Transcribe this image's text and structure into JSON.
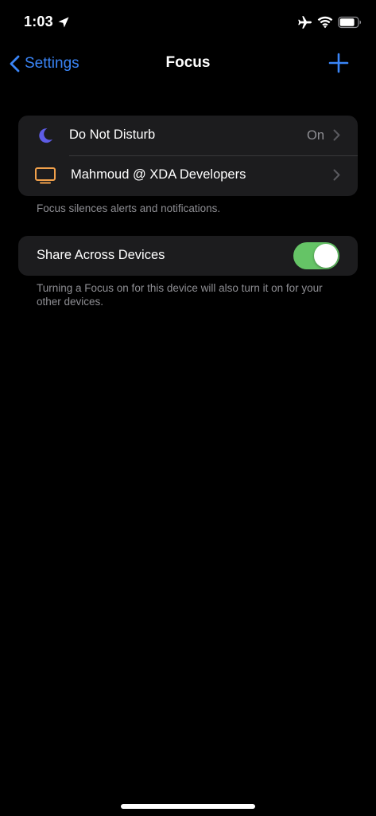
{
  "status_bar": {
    "time": "1:03",
    "icons": [
      "location-arrow-icon",
      "airplane-icon",
      "wifi-icon",
      "battery-icon"
    ]
  },
  "nav": {
    "back_label": "Settings",
    "title": "Focus",
    "add_icon": "plus-icon"
  },
  "focus_list": {
    "items": [
      {
        "label": "Do Not Disturb",
        "value": "On",
        "icon": "moon-icon",
        "icon_color": "#5e5ce6"
      },
      {
        "label": "Mahmoud @ XDA Developers",
        "value": "",
        "icon": "tv-icon",
        "icon_color": "#f0a04b"
      }
    ],
    "footer": "Focus silences alerts and notifications."
  },
  "share": {
    "label": "Share Across Devices",
    "enabled": true,
    "footer": "Turning a Focus on for this device will also turn it on for your other devices."
  },
  "colors": {
    "accent": "#3a85f7",
    "toggle_on": "#65c466",
    "cell_background": "#1c1c1e",
    "secondary_text": "#8e8e93"
  }
}
